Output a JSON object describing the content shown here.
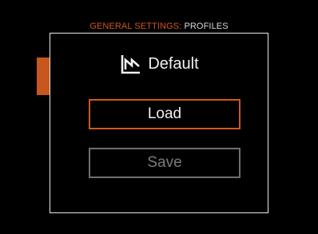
{
  "header": {
    "section": "GENERAL SETTINGS:",
    "page": "PROFILES"
  },
  "profile": {
    "icon": "profile-icon",
    "name": "Default"
  },
  "buttons": {
    "load_label": "Load",
    "save_label": "Save"
  },
  "colors": {
    "accent": "#d2561e",
    "text": "#f0f0f0",
    "disabled": "#7a7a7a",
    "background": "#000000"
  },
  "state": {
    "selected_button": "Load",
    "save_enabled": false
  }
}
